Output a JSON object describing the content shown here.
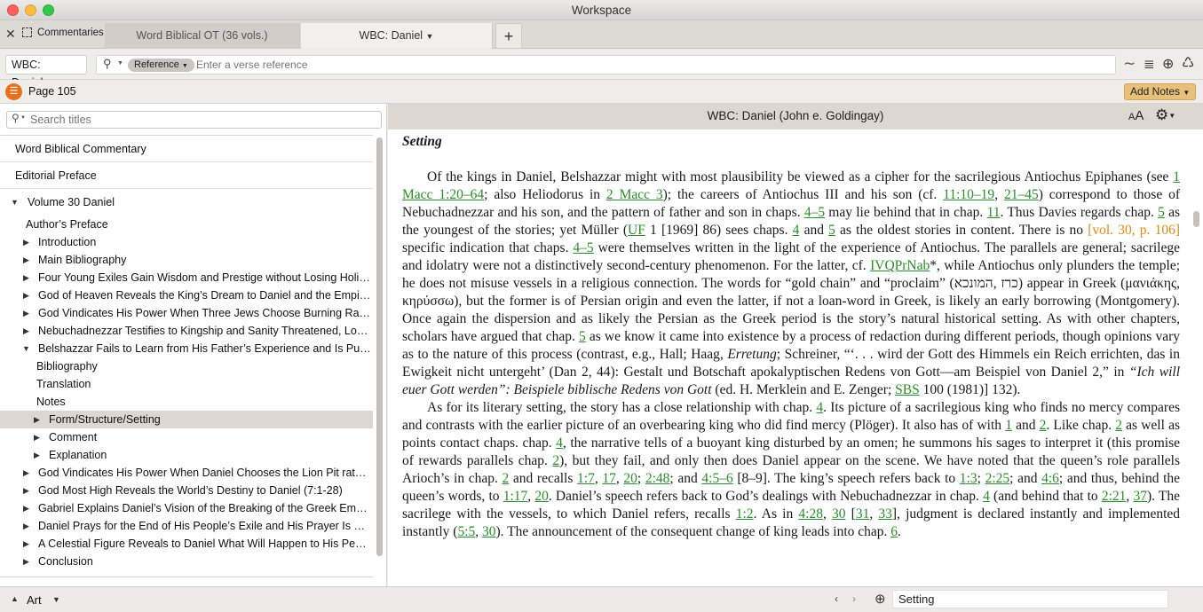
{
  "window": {
    "title": "Workspace"
  },
  "tabs": {
    "panel_label": "Commentaries",
    "tab1": "Word Biblical OT (36 vols.)",
    "tab2": "WBC: Daniel",
    "add": "+"
  },
  "toolbar": {
    "resource": "WBC: Daniel",
    "search_type": "Reference",
    "search_placeholder": "Enter a verse reference"
  },
  "pagebar": {
    "page": "Page 105",
    "add_notes": "Add Notes"
  },
  "sidebar": {
    "search_placeholder": "Search titles",
    "items": [
      {
        "label": "Word Biblical Commentary"
      },
      {
        "label": "Editorial Preface"
      },
      {
        "label": "Volume 30 Daniel"
      },
      {
        "label": "Author’s Preface"
      },
      {
        "label": "Introduction"
      },
      {
        "label": "Main Bibliography"
      },
      {
        "label": "Four Young Exiles Gain Wisdom and Prestige without Losing Holiness..."
      },
      {
        "label": "God of Heaven Reveals the King’s Dream to Daniel and the Empire’s D..."
      },
      {
        "label": "God Vindicates His Power When Three Jews Choose Burning Rather T..."
      },
      {
        "label": "Nebuchadnezzar Testifies to Kingship and Sanity Threatened, Lost, an..."
      },
      {
        "label": "Belshazzar Fails to Learn from His Father’s Experience and Is Put Dow..."
      },
      {
        "label": "Bibliography"
      },
      {
        "label": "Translation"
      },
      {
        "label": "Notes"
      },
      {
        "label": "Form/Structure/Setting"
      },
      {
        "label": "Comment"
      },
      {
        "label": "Explanation"
      },
      {
        "label": "God Vindicates His Power When Daniel Chooses the Lion Pit rather th..."
      },
      {
        "label": "God Most High Reveals the World’s Destiny to Daniel (7:1-28)"
      },
      {
        "label": "Gabriel Explains Daniel’s Vision of the Breaking of the Greek Empire (8..."
      },
      {
        "label": "Daniel Prays for the End of His People’s Exile and His Prayer Is Heard (..."
      },
      {
        "label": "A Celestial Figure Reveals to Daniel What Will Happen to His People a..."
      },
      {
        "label": "Conclusion"
      }
    ]
  },
  "content": {
    "header": "WBC: Daniel (John e. Goldingay)",
    "font_size_label": "AA",
    "heading": "Setting",
    "p1": [
      [
        "t",
        "Of the kings in Daniel, Belshazzar might with most plausibility be viewed as a cipher for the sacrilegious Antiochus Epiphanes (see "
      ],
      [
        "a",
        "1 Macc 1:20–64"
      ],
      [
        "t",
        "; also Heliodorus in "
      ],
      [
        "a",
        "2 Macc 3"
      ],
      [
        "t",
        "); the careers of Antiochus III and his son (cf. "
      ],
      [
        "a",
        "11:10–19"
      ],
      [
        "t",
        ", "
      ],
      [
        "a",
        "21–45"
      ],
      [
        "t",
        ") correspond to those of Nebuchadnezzar and his son, and the pattern of father and son in chaps. "
      ],
      [
        "a",
        "4–5"
      ],
      [
        "t",
        " may lie behind that in chap. "
      ],
      [
        "a",
        "11"
      ],
      [
        "t",
        ". Thus Davies regards chap. "
      ],
      [
        "a",
        "5"
      ],
      [
        "t",
        " as the youngest of the stories; yet Müller ("
      ],
      [
        "a",
        "UF"
      ],
      [
        "t",
        " 1 [1969] 86) sees chaps. "
      ],
      [
        "a",
        "4"
      ],
      [
        "t",
        " and "
      ],
      [
        "a",
        "5"
      ],
      [
        "t",
        " as the oldest stories in content. There is no "
      ],
      [
        "o",
        "[vol. 30, p. 106]"
      ],
      [
        "t",
        " specific indication that chaps. "
      ],
      [
        "a",
        "4–5"
      ],
      [
        "t",
        " were themselves written in the light of the experience of Antiochus. The parallels are general; sacrilege and idolatry were not a distinctively second-century phenomenon. For the latter, cf. "
      ],
      [
        "a",
        "IVQPrNab"
      ],
      [
        "t",
        "*, while Antiochus only plunders the temple; he does not misuse vessels in a religious connection. The words for “gold chain” and “proclaim” (כרז ,המונכא) appear in Greek (μανιάκης, κηρύσσω), but the former is of Persian origin and even the latter, if not a loan-word in Greek, is likely an early borrowing (Montgomery). Once again the dispersion and as likely the Persian as the Greek period is the story’s natural historical setting. As with other chapters, scholars have argued that chap. "
      ],
      [
        "a",
        "5"
      ],
      [
        "t",
        " as we know it came into existence by a process of redaction during different periods, though opinions vary as to the nature of this process (contrast, e.g., Hall; Haag, "
      ],
      [
        "i",
        "Erretung"
      ],
      [
        "t",
        "; Schreiner, “‘. . . wird der Gott des Himmels ein Reich errichten, das in Ewigkeit nicht untergeht’ (Dan 2, 44): Gestalt und Botschaft apokalyptischen Redens von Gott—am Beispiel von Daniel 2,” in "
      ],
      [
        "i",
        "“Ich will euer Gott werden”: Beispiele biblische Redens von Gott"
      ],
      [
        "t",
        " (ed. H. Merklein and E. Zenger; "
      ],
      [
        "a",
        "SBS"
      ],
      [
        "t",
        " 100 (1981)] 132)."
      ]
    ],
    "p2": [
      [
        "t",
        "As for its literary setting, the story has a close relationship with chap. "
      ],
      [
        "a",
        "4"
      ],
      [
        "t",
        ". Its picture of a sacrilegious king who finds no mercy compares and contrasts with the earlier picture of an overbearing king who did find mercy (Plöger). It also has of with "
      ],
      [
        "a",
        "1"
      ],
      [
        "t",
        " and "
      ],
      [
        "a",
        "2"
      ],
      [
        "t",
        ". Like chap. "
      ],
      [
        "a",
        "2"
      ],
      [
        "t",
        " as well as points contact chaps. chap. "
      ],
      [
        "a",
        "4"
      ],
      [
        "t",
        ", the narrative tells of a buoyant king disturbed by an omen; he summons his sages to interpret it (this promise of rewards parallels chap. "
      ],
      [
        "a",
        "2"
      ],
      [
        "t",
        "), but they fail, and only then does Daniel appear on the scene. We have noted that the queen’s role parallels Arioch’s in chap. "
      ],
      [
        "a",
        "2"
      ],
      [
        "t",
        " and recalls "
      ],
      [
        "a",
        "1:7"
      ],
      [
        "t",
        ", "
      ],
      [
        "a",
        "17"
      ],
      [
        "t",
        ", "
      ],
      [
        "a",
        "20"
      ],
      [
        "t",
        "; "
      ],
      [
        "a",
        "2:48"
      ],
      [
        "t",
        "; and "
      ],
      [
        "a",
        "4:5–6"
      ],
      [
        "t",
        " [8–9]. The king’s speech refers back to "
      ],
      [
        "a",
        "1:3"
      ],
      [
        "t",
        "; "
      ],
      [
        "a",
        "2:25"
      ],
      [
        "t",
        "; and "
      ],
      [
        "a",
        "4:6"
      ],
      [
        "t",
        "; and thus, behind the queen’s words, to "
      ],
      [
        "a",
        "1:17"
      ],
      [
        "t",
        ", "
      ],
      [
        "a",
        "20"
      ],
      [
        "t",
        ". Daniel’s speech refers back to God’s dealings with Nebuchadnezzar in chap. "
      ],
      [
        "a",
        "4"
      ],
      [
        "t",
        " (and behind that to "
      ],
      [
        "a",
        "2:21"
      ],
      [
        "t",
        ", "
      ],
      [
        "a",
        "37"
      ],
      [
        "t",
        "). The sacrilege with the vessels, to which Daniel refers, recalls "
      ],
      [
        "a",
        "1:2"
      ],
      [
        "t",
        ". As in "
      ],
      [
        "a",
        "4:28"
      ],
      [
        "t",
        ", "
      ],
      [
        "a",
        "30"
      ],
      [
        "t",
        " ["
      ],
      [
        "a",
        "31"
      ],
      [
        "t",
        ", "
      ],
      [
        "a",
        "33"
      ],
      [
        "t",
        "], judgment is declared instantly and implemented instantly ("
      ],
      [
        "a",
        "5:5"
      ],
      [
        "t",
        ", "
      ],
      [
        "a",
        "30"
      ],
      [
        "t",
        "). The announcement of the consequent change of king leads into chap. "
      ],
      [
        "a",
        "6"
      ],
      [
        "t",
        "."
      ]
    ]
  },
  "bottom": {
    "art_label": "Art",
    "section_label": "Setting"
  },
  "colors": {
    "accent_orange": "#e8701a",
    "link_green": "#2d8a2d",
    "selected_row": "#dcd7d1"
  }
}
